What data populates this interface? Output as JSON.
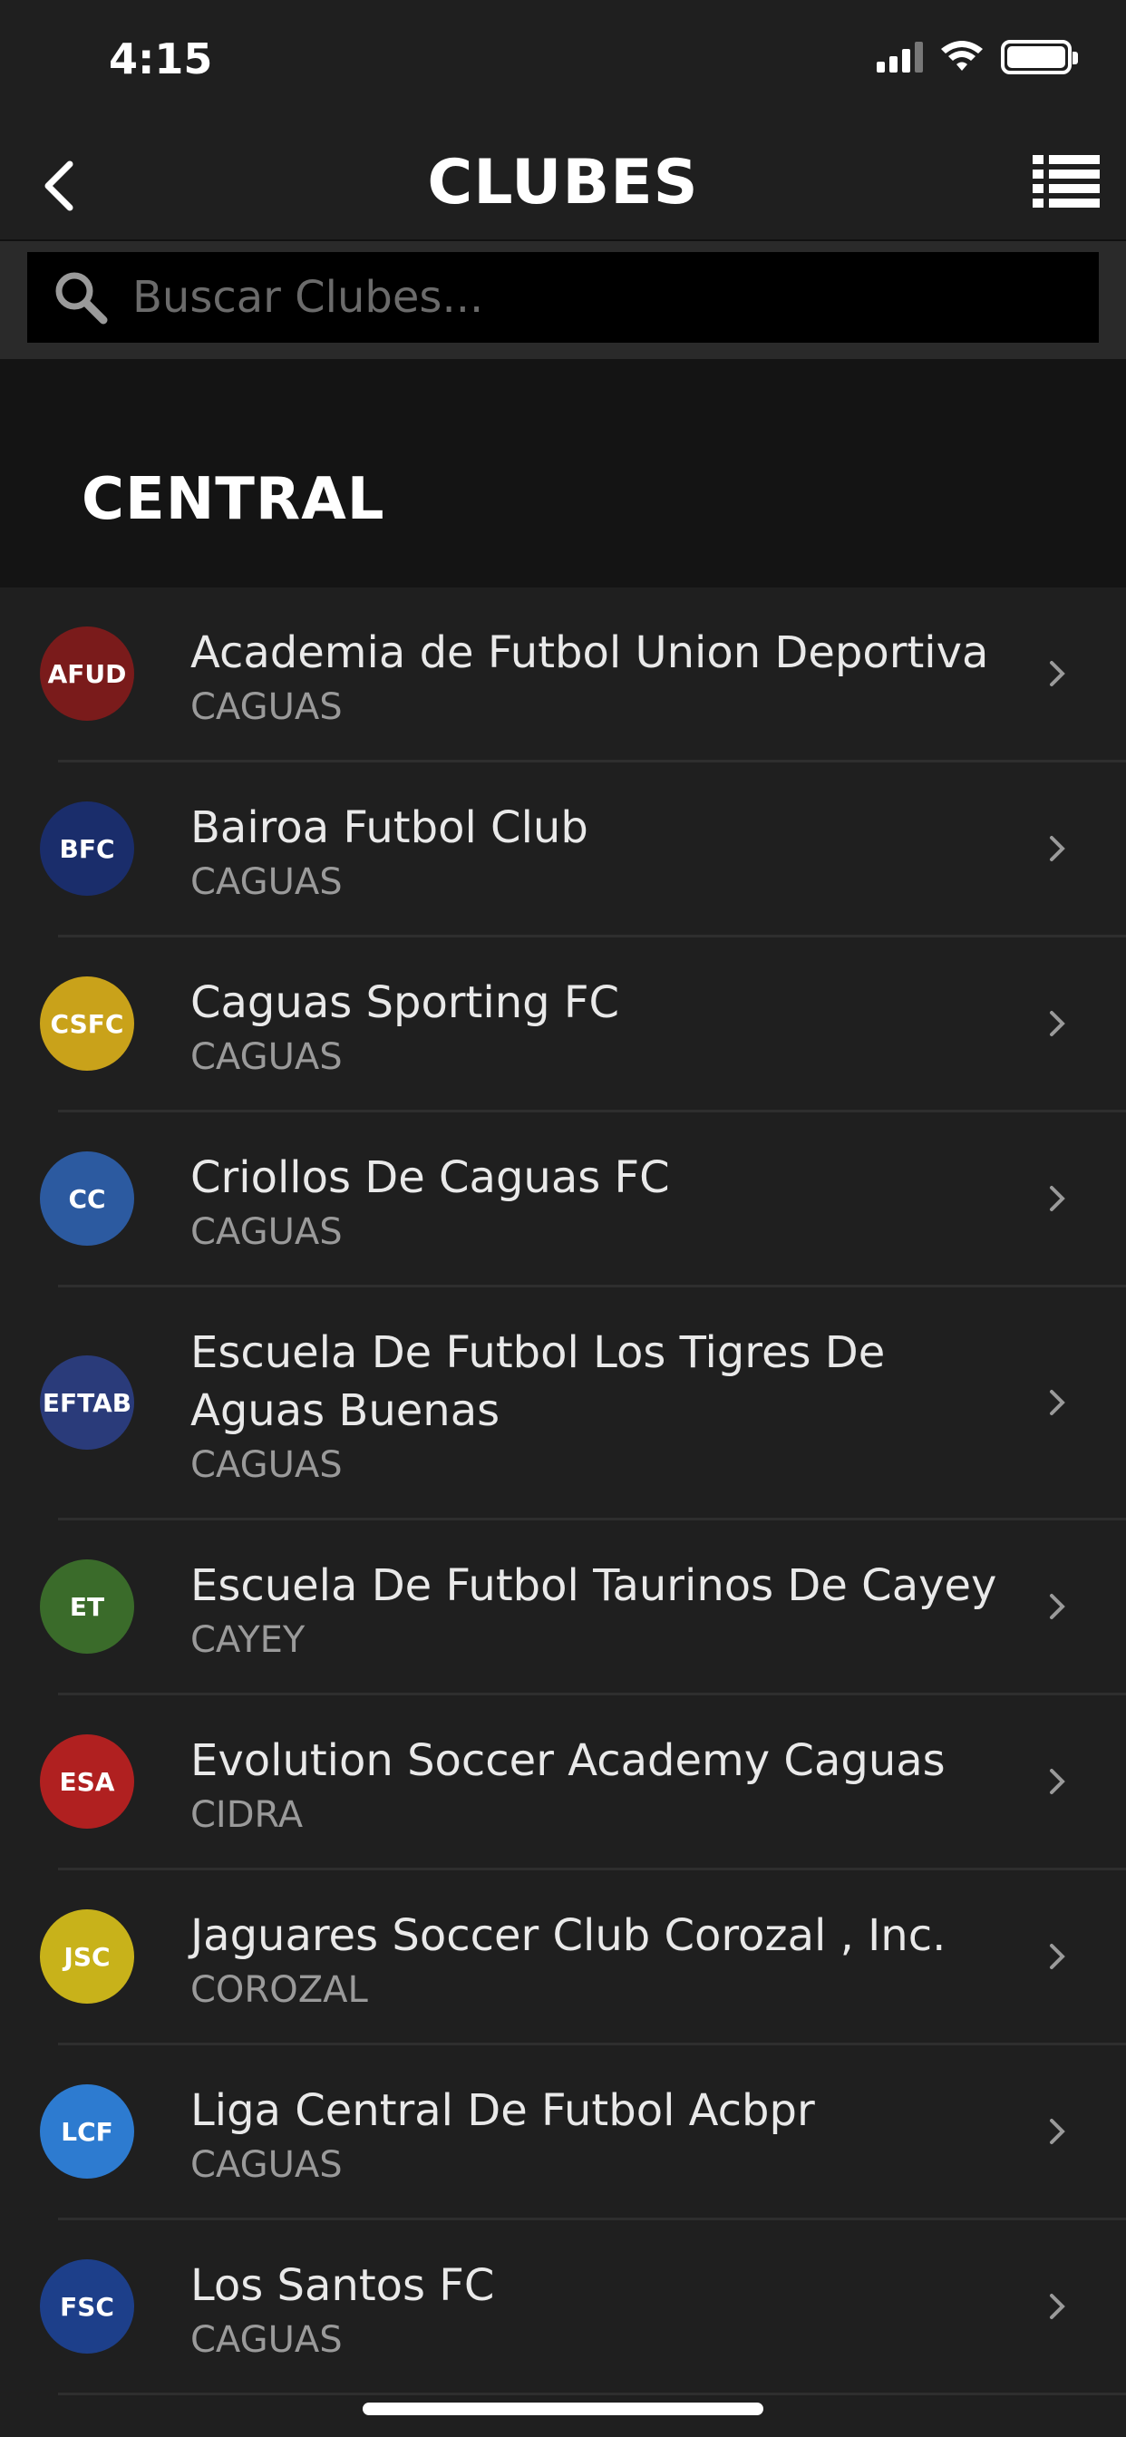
{
  "status_bar": {
    "time": "4:15"
  },
  "nav": {
    "title": "CLUBES"
  },
  "search": {
    "placeholder": "Buscar Clubes..."
  },
  "section": {
    "title": "CENTRAL"
  },
  "clubs": [
    {
      "name": "Academia de Futbol Union Deportiva",
      "city": "CAGUAS",
      "logo_text": "AFUD",
      "logo_color": "#7a1b1b"
    },
    {
      "name": "Bairoa Futbol Club",
      "city": "CAGUAS",
      "logo_text": "BFC",
      "logo_color": "#1a2d6b"
    },
    {
      "name": "Caguas Sporting FC",
      "city": "CAGUAS",
      "logo_text": "CSFC",
      "logo_color": "#c9a21a"
    },
    {
      "name": "Criollos De Caguas FC",
      "city": "CAGUAS",
      "logo_text": "CC",
      "logo_color": "#2c5aa0"
    },
    {
      "name": "Escuela De Futbol Los Tigres De Aguas Buenas",
      "city": "CAGUAS",
      "logo_text": "EFTAB",
      "logo_color": "#2a3b7a"
    },
    {
      "name": "Escuela De Futbol Taurinos De Cayey",
      "city": "CAYEY",
      "logo_text": "ET",
      "logo_color": "#3a6b2a"
    },
    {
      "name": "Evolution Soccer Academy Caguas",
      "city": "CIDRA",
      "logo_text": "ESA",
      "logo_color": "#b02020"
    },
    {
      "name": "Jaguares Soccer Club Corozal , Inc.",
      "city": "COROZAL",
      "logo_text": "JSC",
      "logo_color": "#c8b21a"
    },
    {
      "name": "Liga Central De Futbol Acbpr",
      "city": "CAGUAS",
      "logo_text": "LCF",
      "logo_color": "#2d7bd0"
    },
    {
      "name": "Los Santos FC",
      "city": "CAGUAS",
      "logo_text": "FSC",
      "logo_color": "#1d3f8a"
    }
  ]
}
